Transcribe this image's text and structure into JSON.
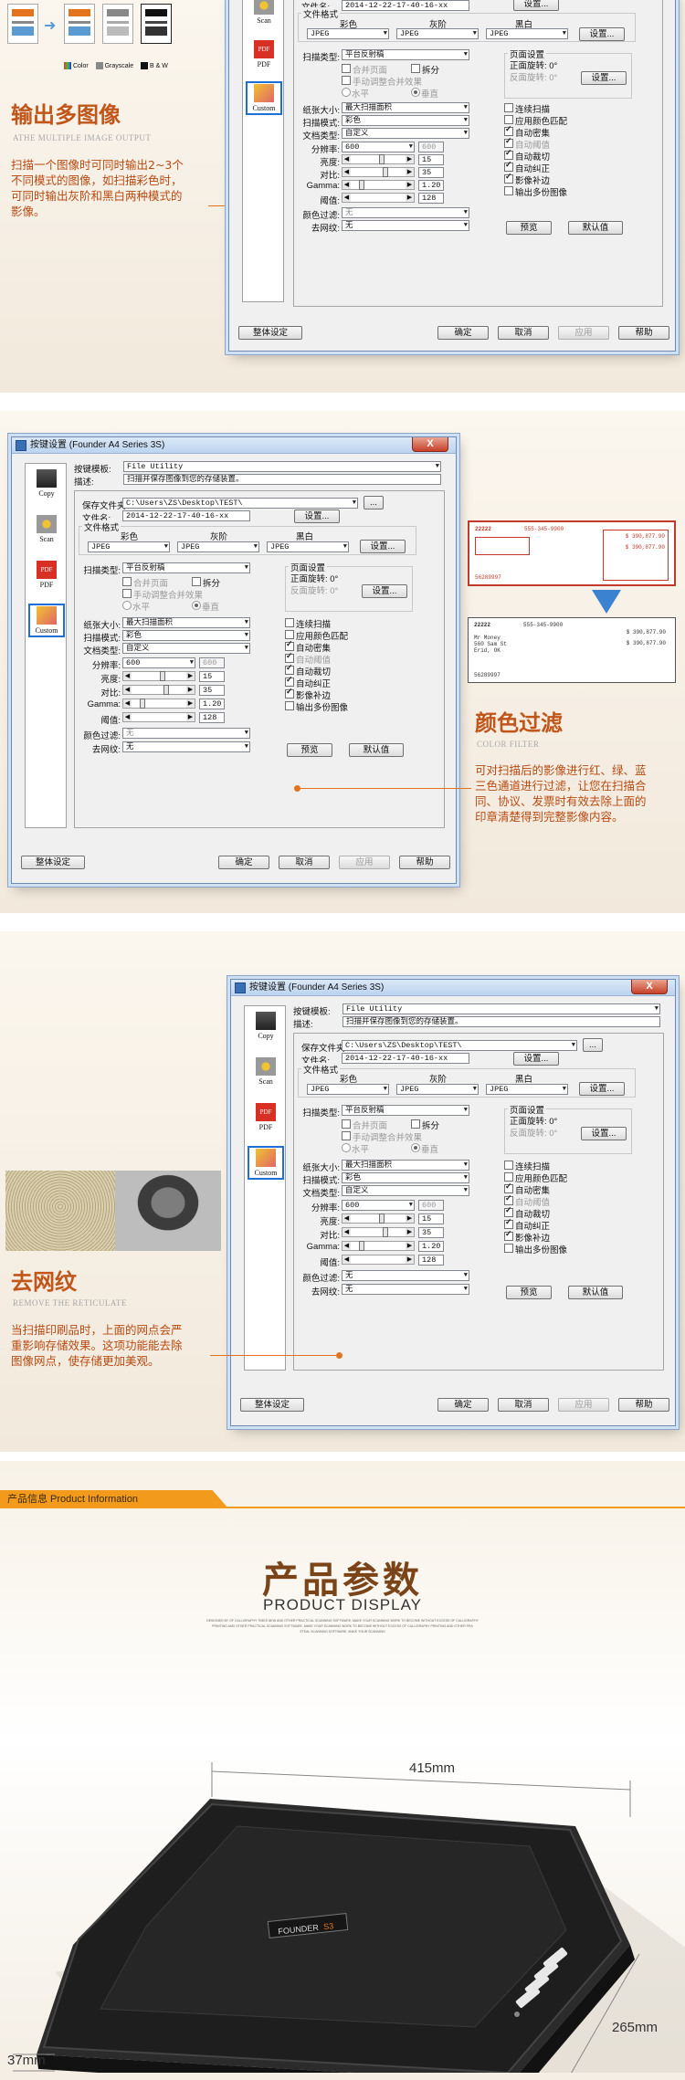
{
  "dialog": {
    "title": "按键设置 (Founder A4 Series 3S)",
    "close": "X",
    "left_icons": [
      {
        "label": "Copy",
        "icon": "printer-icon"
      },
      {
        "label": "Scan",
        "icon": "scan-icon"
      },
      {
        "label": "PDF",
        "icon": "pdf-icon"
      },
      {
        "label": "Custom",
        "icon": "custom-icon"
      }
    ],
    "button_template_label": "按键模板:",
    "button_template_value": "File Utility",
    "description_label": "描述:",
    "description_value": "扫描并保存图像到您的存储装置。",
    "save_folder_label": "保存文件夹:",
    "save_folder_value": "C:\\Users\\ZS\\Desktop\\TEST\\",
    "browse": "...",
    "filename_label": "文件名:",
    "filename_value": "2014-12-22-17-40-16-xx",
    "settings_button": "设置...",
    "file_format_label": "文件格式",
    "color_label": "彩色",
    "gray_label": "灰阶",
    "bw_label": "黑白",
    "format_value": "JPEG",
    "scan_type_label": "扫描类型:",
    "scan_type_value": "平台反射稿",
    "merge_pages": "合并页面",
    "split": "拆分",
    "manual_merge": "手动调整合并效果",
    "horizontal": "水平",
    "vertical": "垂直",
    "page_settings_label": "页面设置",
    "front_rotate": "正面旋转: 0°",
    "back_rotate": "反面旋转: 0°",
    "page_settings_button": "设置...",
    "paper_size_label": "纸张大小:",
    "paper_size_value": "最大扫描面积",
    "scan_mode_label": "扫描模式:",
    "scan_mode_value": "彩色",
    "doc_type_label": "文档类型:",
    "doc_type_value": "自定义",
    "resolution_label": "分辨率:",
    "resolution_value": "600",
    "resolution_alt": "600",
    "brightness_label": "亮度:",
    "brightness_value": "15",
    "contrast_label": "对比:",
    "contrast_value": "35",
    "gamma_label": "Gamma:",
    "gamma_value": "1.20",
    "threshold_label": "阈值:",
    "threshold_value": "128",
    "color_filter_label": "颜色过滤:",
    "color_filter_value": "无",
    "descreen_label": "去网纹:",
    "descreen_value": "无",
    "options": [
      {
        "label": "连续扫描",
        "checked": false,
        "disabled": false
      },
      {
        "label": "应用颜色匹配",
        "checked": false,
        "disabled": false
      },
      {
        "label": "自动密集",
        "checked": true,
        "disabled": false
      },
      {
        "label": "自动阈值",
        "checked": true,
        "disabled": true
      },
      {
        "label": "自动裁切",
        "checked": true,
        "disabled": false
      },
      {
        "label": "自动纠正",
        "checked": true,
        "disabled": false
      },
      {
        "label": "影像补边",
        "checked": true,
        "disabled": false
      },
      {
        "label": "输出多份图像",
        "checked": false,
        "disabled": false
      }
    ],
    "preview": "预览",
    "default": "默认值",
    "overall": "整体设定",
    "ok": "确定",
    "cancel": "取消",
    "apply": "应用",
    "help": "帮助"
  },
  "section1": {
    "title": "输出多图像",
    "subtitle": "ATHE MULTIPLE IMAGE OUTPUT",
    "desc": [
      "扫描一个图像时可同时输出2~3个",
      "不同模式的图像，如扫描彩色时，",
      "可同时输出灰阶和黑白两种模式的",
      "影像。"
    ],
    "legend": [
      "Color",
      "Grayscale",
      "B & W"
    ]
  },
  "section2": {
    "title": "颜色过滤",
    "subtitle": "COLOR FILTER",
    "desc": [
      "可对扫描后的影像进行红、绿、蓝",
      "三色通道进行过滤，让您在扫描合",
      "同、协议、发票时有效去除上面的",
      "印章清楚得到完整影像内容。"
    ],
    "check_number": "22222",
    "check_phone": "555-345-9900",
    "check_amount1": "$ 390,877.90",
    "check_amount2": "$ 390,877.90",
    "check_payee": [
      "Mr Money",
      "560 Sam St",
      "Erid, OK"
    ],
    "check_account": "56289997"
  },
  "section3": {
    "title": "去网纹",
    "subtitle": "REMOVE THE RETICULATE",
    "desc": [
      "当扫描印刷品时，上面的网点会严",
      "重影响存储效果。这项功能能去除",
      "图像网点，使存储更加美观。"
    ]
  },
  "product_info": {
    "bar_label": "产品信息 Product Information",
    "title": "产品参数",
    "subtitle": "PRODUCT DISPLAY",
    "fine": [
      "DESIGNED BY OF CALLIGRAPHY TIMES NEW AND OTHER PRACTICAL SCANNING SOFTWARE, MAKE YOUR SCANNING WORK TO BECOME WITHOUT EXCESS OF CALLIGRAPHY",
      "PRINTING AND OTHER PRACTICAL SCANNING SOFTWARE, MAKE YOUR SCANNING WORK TO BECOME WITHOUT EXCESS OF CALLIGRAPHY PRINTING AND OTHER PRA",
      "STEAL SCANNING SOFTWARE, MAKE YOUR SCANNING"
    ],
    "brand": "FOUNDER",
    "model": "S3",
    "width_label": "415mm",
    "height_label": "37mm",
    "depth_label": "265mm"
  },
  "colors": {
    "accent": "#e4731e",
    "title": "#c0561a",
    "bar": "#f29a1c"
  }
}
